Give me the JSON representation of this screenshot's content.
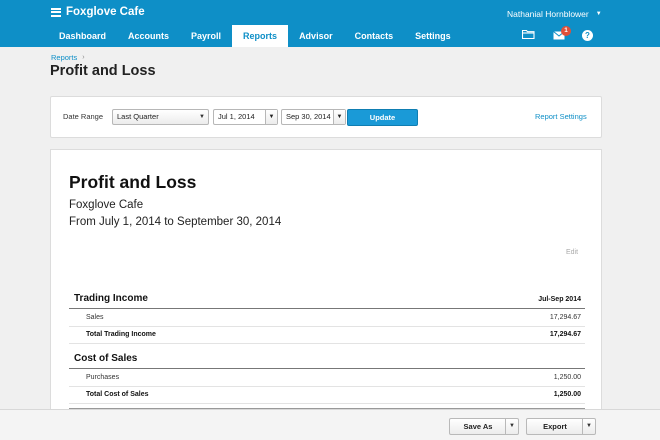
{
  "header": {
    "org_name": "Foxglove Cafe",
    "user_name": "Nathanial Hornblower",
    "notification_count": "1",
    "help_label": "?"
  },
  "nav": {
    "tabs": [
      {
        "label": "Dashboard",
        "active": false
      },
      {
        "label": "Accounts",
        "active": false
      },
      {
        "label": "Payroll",
        "active": false
      },
      {
        "label": "Reports",
        "active": true
      },
      {
        "label": "Advisor",
        "active": false
      },
      {
        "label": "Contacts",
        "active": false
      },
      {
        "label": "Settings",
        "active": false
      }
    ]
  },
  "page": {
    "breadcrumb": "Reports",
    "title": "Profit and Loss"
  },
  "filter": {
    "date_range_label": "Date Range",
    "date_range_value": "Last Quarter",
    "start_date": "Jul 1, 2014",
    "end_date": "Sep 30, 2014",
    "update_label": "Update",
    "report_settings_label": "Report Settings"
  },
  "report": {
    "title": "Profit and Loss",
    "organisation": "Foxglove Cafe",
    "period": "From July 1, 2014 to September 30, 2014",
    "edit_label": "Edit",
    "column_header": "Jul-Sep 2014",
    "sections": {
      "trading_income": {
        "title": "Trading Income",
        "rows": [
          {
            "label": "Sales",
            "value": "17,294.67"
          }
        ],
        "total_label": "Total Trading Income",
        "total_value": "17,294.67"
      },
      "cost_of_sales": {
        "title": "Cost of Sales",
        "rows": [
          {
            "label": "Purchases",
            "value": "1,250.00"
          }
        ],
        "total_label": "Total Cost of Sales",
        "total_value": "1,250.00"
      }
    }
  },
  "footer": {
    "save_as_label": "Save As",
    "export_label": "Export"
  },
  "colors": {
    "brand_blue": "#0e8fc7",
    "badge_red": "#e0503a",
    "update_button": "#1a9ad7"
  }
}
